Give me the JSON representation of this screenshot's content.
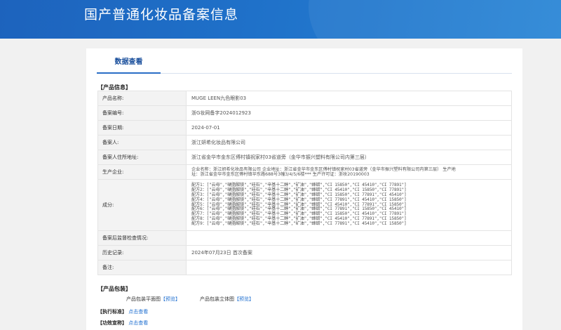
{
  "header": {
    "title": "国产普通化妆品备案信息"
  },
  "tabs": [
    {
      "label": "数据查看"
    }
  ],
  "product_info": {
    "section_title": "【产品信息】",
    "rows": {
      "name": {
        "label": "产品名称:",
        "value": "MUGE LEEN九色眼影03"
      },
      "record_no": {
        "label": "备案编号:",
        "value": "浙G妆网备字2024012923"
      },
      "record_date": {
        "label": "备案日期:",
        "value": "2024-07-01"
      },
      "filer": {
        "label": "备案人:",
        "value": "浙江妍希化妆品有限公司"
      },
      "address": {
        "label": "备案人住所地址:",
        "value": "浙江省金华市金东区傅村镇祝家村03省道旁（金华市振兴塑料有限公司内第三层）"
      },
      "producer": {
        "label": "生产企业:",
        "line1": "企业名称：浙江妍希化妆品有限公司 企业地址：浙江省金华市金东区傅村镇祝家村03省道旁（金华市振兴塑料有限公司内第三层） 生产地",
        "line2": "址：浙江省金华市金东区傅村镇华东路688号3幢3/4/5/6楼*** 生产许可证：浙妆20190003"
      },
      "ingredients": {
        "label": "成分:",
        "lines": [
          "配方1：[\"云母\",\"硬脂酸镁\",\"硅石\",\"辛基十二醇\",\"矿油\",\"蜂蜡\",\"CI 15850\",\"CI 45410\",\"CI 77891\"]",
          "配方2：[\"云母\",\"硬脂酸镁\",\"硅石\",\"辛基十二醇\",\"矿油\",\"蜂蜡\",\"CI 45410\",\"CI 15850\",\"CI 77891\"]",
          "配方3：[\"云母\",\"硬脂酸镁\",\"硅石\",\"辛基十二醇\",\"矿油\",\"蜂蜡\",\"CI 15850\",\"CI 77891\",\"CI 45410\"]",
          "配方4：[\"云母\",\"硬脂酸镁\",\"硅石\",\"辛基十二醇\",\"矿油\",\"蜂蜡\",\"CI 77891\",\"CI 45410\",\"CI 15850\"]",
          "配方5：[\"云母\",\"硬脂酸镁\",\"硅石\",\"辛基十二醇\",\"矿油\",\"蜂蜡\",\"CI 45410\",\"CI 77891\",\"CI 15850\"]",
          "配方6：[\"云母\",\"硬脂酸镁\",\"硅石\",\"辛基十二醇\",\"矿油\",\"蜂蜡\",\"CI 77891\",\"CI 15850\",\"CI 45410\"]",
          "配方7：[\"云母\",\"硬脂酸镁\",\"硅石\",\"辛基十二醇\",\"矿油\",\"蜂蜡\",\"CI 15850\",\"CI 45410\",\"CI 77891\"]",
          "配方8：[\"云母\",\"硬脂酸镁\",\"硅石\",\"辛基十二醇\",\"矿油\",\"蜂蜡\",\"CI 45410\",\"CI 77891\",\"CI 15850\"]",
          "配方9：[\"云母\",\"硬脂酸镁\",\"硅石\",\"辛基十二醇\",\"矿油\",\"蜂蜡\",\"CI 77891\",\"CI 45410\",\"CI 15850\"]"
        ]
      },
      "inspection": {
        "label": "备案后监督检查情况:",
        "value": ""
      },
      "history": {
        "label": "历史记录:",
        "value": "2024年07月23日 首次备案"
      },
      "remark": {
        "label": "备注:",
        "value": ""
      }
    }
  },
  "packaging": {
    "section_title": "【产品包装】",
    "flat_label": "产品包装平面图",
    "flat_link": "【预览】",
    "solid_label": "产品包装立体图",
    "solid_link": "【预览】"
  },
  "standard": {
    "title": "【执行标准】",
    "link": "点击查看"
  },
  "efficacy": {
    "title": "【功效宣称】",
    "link": "点击查看"
  },
  "colors": {
    "banner": "#1f6cc4",
    "tab_active": "#2a6ec6",
    "link": "#1f6fd0",
    "key_bg": "#f3f3f3"
  }
}
